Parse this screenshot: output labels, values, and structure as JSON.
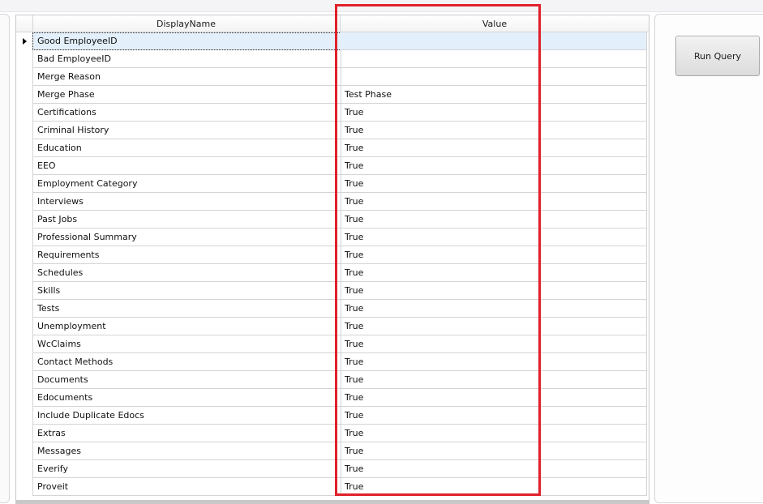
{
  "grid": {
    "columns": [
      "DisplayName",
      "Value"
    ],
    "selected_row_index": 0,
    "rows": [
      {
        "name": "Good EmployeeID",
        "value": ""
      },
      {
        "name": "Bad EmployeeID",
        "value": ""
      },
      {
        "name": "Merge Reason",
        "value": ""
      },
      {
        "name": "Merge Phase",
        "value": "Test Phase"
      },
      {
        "name": "Certifications",
        "value": "True"
      },
      {
        "name": "Criminal History",
        "value": "True"
      },
      {
        "name": "Education",
        "value": "True"
      },
      {
        "name": "EEO",
        "value": "True"
      },
      {
        "name": "Employment Category",
        "value": "True"
      },
      {
        "name": "Interviews",
        "value": "True"
      },
      {
        "name": "Past Jobs",
        "value": "True"
      },
      {
        "name": "Professional Summary",
        "value": "True"
      },
      {
        "name": "Requirements",
        "value": "True"
      },
      {
        "name": "Schedules",
        "value": "True"
      },
      {
        "name": "Skills",
        "value": "True"
      },
      {
        "name": "Tests",
        "value": "True"
      },
      {
        "name": "Unemployment",
        "value": "True"
      },
      {
        "name": "WcClaims",
        "value": "True"
      },
      {
        "name": "Contact Methods",
        "value": "True"
      },
      {
        "name": "Documents",
        "value": "True"
      },
      {
        "name": "Edocuments",
        "value": "True"
      },
      {
        "name": "Include Duplicate Edocs",
        "value": "True"
      },
      {
        "name": "Extras",
        "value": "True"
      },
      {
        "name": "Messages",
        "value": "True"
      },
      {
        "name": "Everify",
        "value": "True"
      },
      {
        "name": "Proveit",
        "value": "True"
      }
    ]
  },
  "actions": {
    "run_query_label": "Run Query"
  },
  "colors": {
    "highlight": "#e0202b",
    "selected_row": "#e3effb"
  }
}
